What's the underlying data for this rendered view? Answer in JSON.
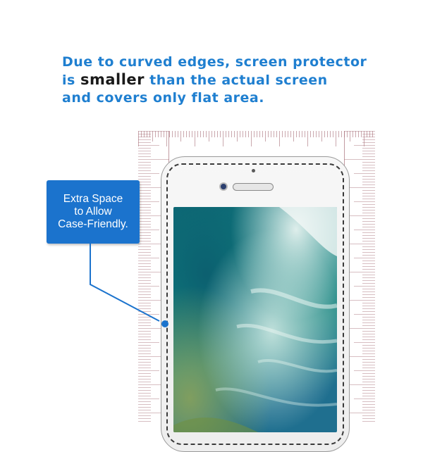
{
  "headline": {
    "line1": "Due to curved edges, screen protector",
    "line2_before": "is",
    "line2_emphasis": "smaller",
    "line2_after": "than the actual screen",
    "line3": "and covers only flat area."
  },
  "callout": {
    "line1": "Extra Space",
    "line2": "to Allow",
    "line3": "Case-Friendly."
  },
  "colors": {
    "headline": "#1f7fd0",
    "emphasis": "#1a1a1a",
    "callout_bg": "#1b73cd",
    "ruler": "#a8707a",
    "outline_dashed": "#3a3a3a"
  },
  "icons": [
    "front-camera-icon",
    "earpiece-speaker-icon",
    "proximity-sensor-icon",
    "callout-pointer-dot"
  ]
}
